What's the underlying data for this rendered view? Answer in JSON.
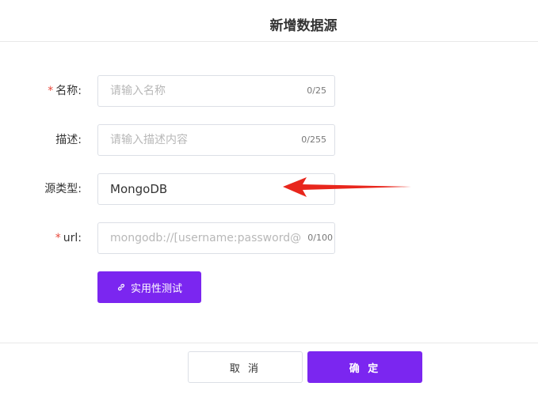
{
  "dialog": {
    "title": "新增数据源"
  },
  "form": {
    "name": {
      "label": "名称:",
      "required": true,
      "placeholder": "请输入名称",
      "value": "",
      "counter": "0/25"
    },
    "description": {
      "label": "描述:",
      "required": false,
      "placeholder": "请输入描述内容",
      "value": "",
      "counter": "0/255"
    },
    "source_type": {
      "label": "源类型:",
      "required": false,
      "value": "MongoDB"
    },
    "url": {
      "label": "url:",
      "required": true,
      "placeholder": "mongodb://[username:password@]",
      "value": "",
      "counter": "0/100"
    },
    "required_mark": "*"
  },
  "test_button": {
    "label": "实用性测试",
    "icon": "link-icon"
  },
  "footer": {
    "cancel_label": "取 消",
    "confirm_label": "确 定"
  },
  "colors": {
    "primary": "#7b26f0",
    "required": "#e8483b",
    "arrow": "#e8261c"
  }
}
